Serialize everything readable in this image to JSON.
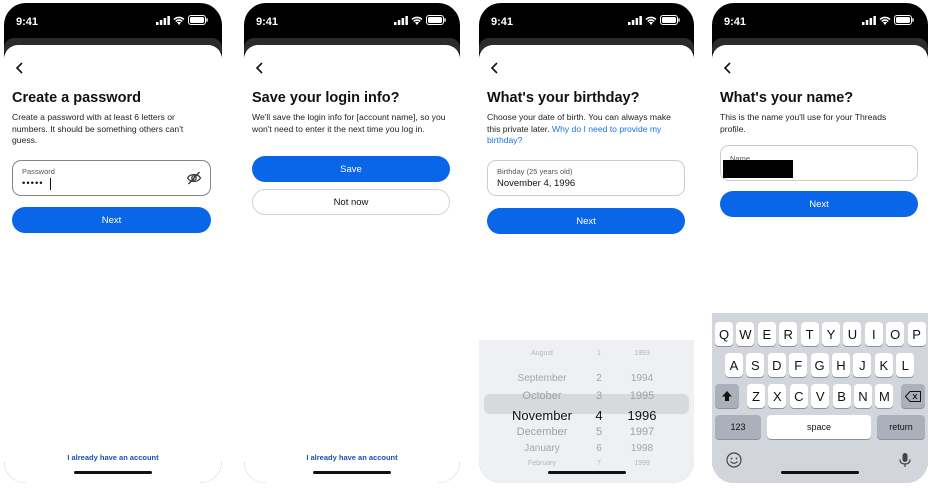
{
  "status_time": "9:41",
  "footer_link": "I already have an account",
  "screen1": {
    "title": "Create a password",
    "description": "Create a password with at least 6 letters or numbers. It should be something others can't guess.",
    "field_label": "Password",
    "field_value": "•••••",
    "next_label": "Next"
  },
  "screen2": {
    "title": "Save your login info?",
    "description": "We'll save the login info for [account name], so you won't need to enter it the next time you log in.",
    "save_label": "Save",
    "not_now_label": "Not now"
  },
  "screen3": {
    "title": "What's your birthday?",
    "description": "Choose your date of birth. You can always make this private later.",
    "help_link": "Why do I need to provide my birthday?",
    "field_label": "Birthday (25 years old)",
    "field_value": "November 4, 1996",
    "next_label": "Next",
    "picker_rows": [
      {
        "month": "August",
        "day": "1",
        "year": "1993"
      },
      {
        "month": "September",
        "day": "2",
        "year": "1994"
      },
      {
        "month": "October",
        "day": "3",
        "year": "1995"
      },
      {
        "month": "November",
        "day": "4",
        "year": "1996"
      },
      {
        "month": "December",
        "day": "5",
        "year": "1997"
      },
      {
        "month": "January",
        "day": "6",
        "year": "1998"
      },
      {
        "month": "February",
        "day": "7",
        "year": "1999"
      }
    ]
  },
  "screen4": {
    "title": "What's your name?",
    "description": "This is the name you'll use for your Threads profile.",
    "field_label": "Name",
    "next_label": "Next",
    "keyboard": {
      "row1": [
        "Q",
        "W",
        "E",
        "R",
        "T",
        "Y",
        "U",
        "I",
        "O",
        "P"
      ],
      "row2": [
        "A",
        "S",
        "D",
        "F",
        "G",
        "H",
        "J",
        "K",
        "L"
      ],
      "row3": [
        "Z",
        "X",
        "C",
        "V",
        "B",
        "N",
        "M"
      ],
      "numbers_label": "123",
      "space_label": "space",
      "return_label": "return"
    }
  }
}
